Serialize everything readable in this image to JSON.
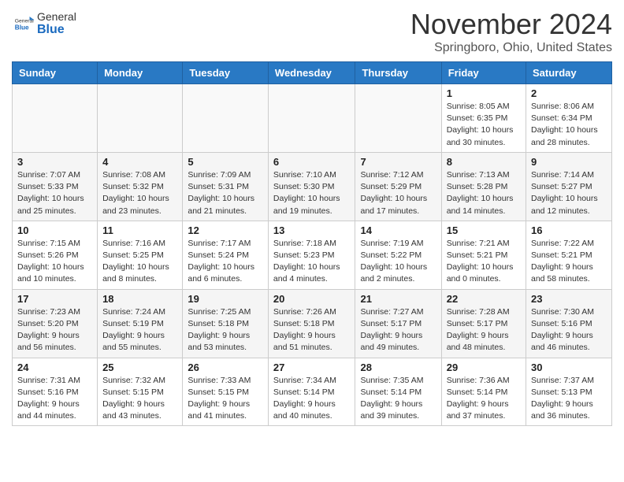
{
  "header": {
    "logo_general": "General",
    "logo_blue": "Blue",
    "month_title": "November 2024",
    "location": "Springboro, Ohio, United States"
  },
  "weekdays": [
    "Sunday",
    "Monday",
    "Tuesday",
    "Wednesday",
    "Thursday",
    "Friday",
    "Saturday"
  ],
  "weeks": [
    [
      null,
      null,
      null,
      null,
      null,
      {
        "day": "1",
        "sunrise": "8:05 AM",
        "sunset": "6:35 PM",
        "daylight": "10 hours and 30 minutes."
      },
      {
        "day": "2",
        "sunrise": "8:06 AM",
        "sunset": "6:34 PM",
        "daylight": "10 hours and 28 minutes."
      }
    ],
    [
      {
        "day": "3",
        "sunrise": "7:07 AM",
        "sunset": "5:33 PM",
        "daylight": "10 hours and 25 minutes."
      },
      {
        "day": "4",
        "sunrise": "7:08 AM",
        "sunset": "5:32 PM",
        "daylight": "10 hours and 23 minutes."
      },
      {
        "day": "5",
        "sunrise": "7:09 AM",
        "sunset": "5:31 PM",
        "daylight": "10 hours and 21 minutes."
      },
      {
        "day": "6",
        "sunrise": "7:10 AM",
        "sunset": "5:30 PM",
        "daylight": "10 hours and 19 minutes."
      },
      {
        "day": "7",
        "sunrise": "7:12 AM",
        "sunset": "5:29 PM",
        "daylight": "10 hours and 17 minutes."
      },
      {
        "day": "8",
        "sunrise": "7:13 AM",
        "sunset": "5:28 PM",
        "daylight": "10 hours and 14 minutes."
      },
      {
        "day": "9",
        "sunrise": "7:14 AM",
        "sunset": "5:27 PM",
        "daylight": "10 hours and 12 minutes."
      }
    ],
    [
      {
        "day": "10",
        "sunrise": "7:15 AM",
        "sunset": "5:26 PM",
        "daylight": "10 hours and 10 minutes."
      },
      {
        "day": "11",
        "sunrise": "7:16 AM",
        "sunset": "5:25 PM",
        "daylight": "10 hours and 8 minutes."
      },
      {
        "day": "12",
        "sunrise": "7:17 AM",
        "sunset": "5:24 PM",
        "daylight": "10 hours and 6 minutes."
      },
      {
        "day": "13",
        "sunrise": "7:18 AM",
        "sunset": "5:23 PM",
        "daylight": "10 hours and 4 minutes."
      },
      {
        "day": "14",
        "sunrise": "7:19 AM",
        "sunset": "5:22 PM",
        "daylight": "10 hours and 2 minutes."
      },
      {
        "day": "15",
        "sunrise": "7:21 AM",
        "sunset": "5:21 PM",
        "daylight": "10 hours and 0 minutes."
      },
      {
        "day": "16",
        "sunrise": "7:22 AM",
        "sunset": "5:21 PM",
        "daylight": "9 hours and 58 minutes."
      }
    ],
    [
      {
        "day": "17",
        "sunrise": "7:23 AM",
        "sunset": "5:20 PM",
        "daylight": "9 hours and 56 minutes."
      },
      {
        "day": "18",
        "sunrise": "7:24 AM",
        "sunset": "5:19 PM",
        "daylight": "9 hours and 55 minutes."
      },
      {
        "day": "19",
        "sunrise": "7:25 AM",
        "sunset": "5:18 PM",
        "daylight": "9 hours and 53 minutes."
      },
      {
        "day": "20",
        "sunrise": "7:26 AM",
        "sunset": "5:18 PM",
        "daylight": "9 hours and 51 minutes."
      },
      {
        "day": "21",
        "sunrise": "7:27 AM",
        "sunset": "5:17 PM",
        "daylight": "9 hours and 49 minutes."
      },
      {
        "day": "22",
        "sunrise": "7:28 AM",
        "sunset": "5:17 PM",
        "daylight": "9 hours and 48 minutes."
      },
      {
        "day": "23",
        "sunrise": "7:30 AM",
        "sunset": "5:16 PM",
        "daylight": "9 hours and 46 minutes."
      }
    ],
    [
      {
        "day": "24",
        "sunrise": "7:31 AM",
        "sunset": "5:16 PM",
        "daylight": "9 hours and 44 minutes."
      },
      {
        "day": "25",
        "sunrise": "7:32 AM",
        "sunset": "5:15 PM",
        "daylight": "9 hours and 43 minutes."
      },
      {
        "day": "26",
        "sunrise": "7:33 AM",
        "sunset": "5:15 PM",
        "daylight": "9 hours and 41 minutes."
      },
      {
        "day": "27",
        "sunrise": "7:34 AM",
        "sunset": "5:14 PM",
        "daylight": "9 hours and 40 minutes."
      },
      {
        "day": "28",
        "sunrise": "7:35 AM",
        "sunset": "5:14 PM",
        "daylight": "9 hours and 39 minutes."
      },
      {
        "day": "29",
        "sunrise": "7:36 AM",
        "sunset": "5:14 PM",
        "daylight": "9 hours and 37 minutes."
      },
      {
        "day": "30",
        "sunrise": "7:37 AM",
        "sunset": "5:13 PM",
        "daylight": "9 hours and 36 minutes."
      }
    ]
  ]
}
